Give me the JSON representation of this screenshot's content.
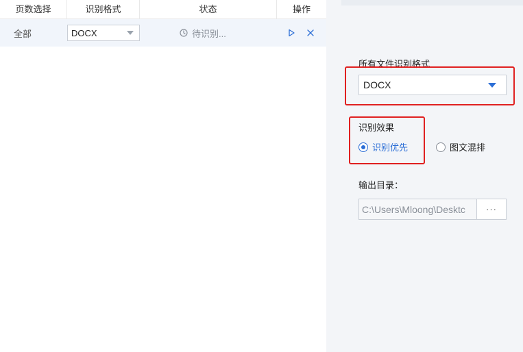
{
  "table": {
    "headers": {
      "page_select": "页数选择",
      "format": "识别格式",
      "status": "状态",
      "action": "操作"
    },
    "rows": [
      {
        "page": "全部",
        "format": "DOCX",
        "status": "待识别..."
      }
    ]
  },
  "settings": {
    "format_label": "所有文件识别格式",
    "format_value": "DOCX",
    "effect_label": "识别效果",
    "effect_options": [
      {
        "label": "识别优先",
        "checked": true
      },
      {
        "label": "图文混排",
        "checked": false
      }
    ],
    "output_label": "输出目录：",
    "output_path": "C:\\Users\\Mloong\\Desktc",
    "browse_label": "···"
  },
  "colors": {
    "accent": "#2d6fd6",
    "highlight_box": "#e02020",
    "row_bg": "#f1f5fb",
    "panel_bg": "#f3f5f8"
  },
  "icons": {
    "status": "clock-icon",
    "start": "play-icon",
    "remove": "close-icon",
    "dropdown": "chevron-down-icon"
  }
}
